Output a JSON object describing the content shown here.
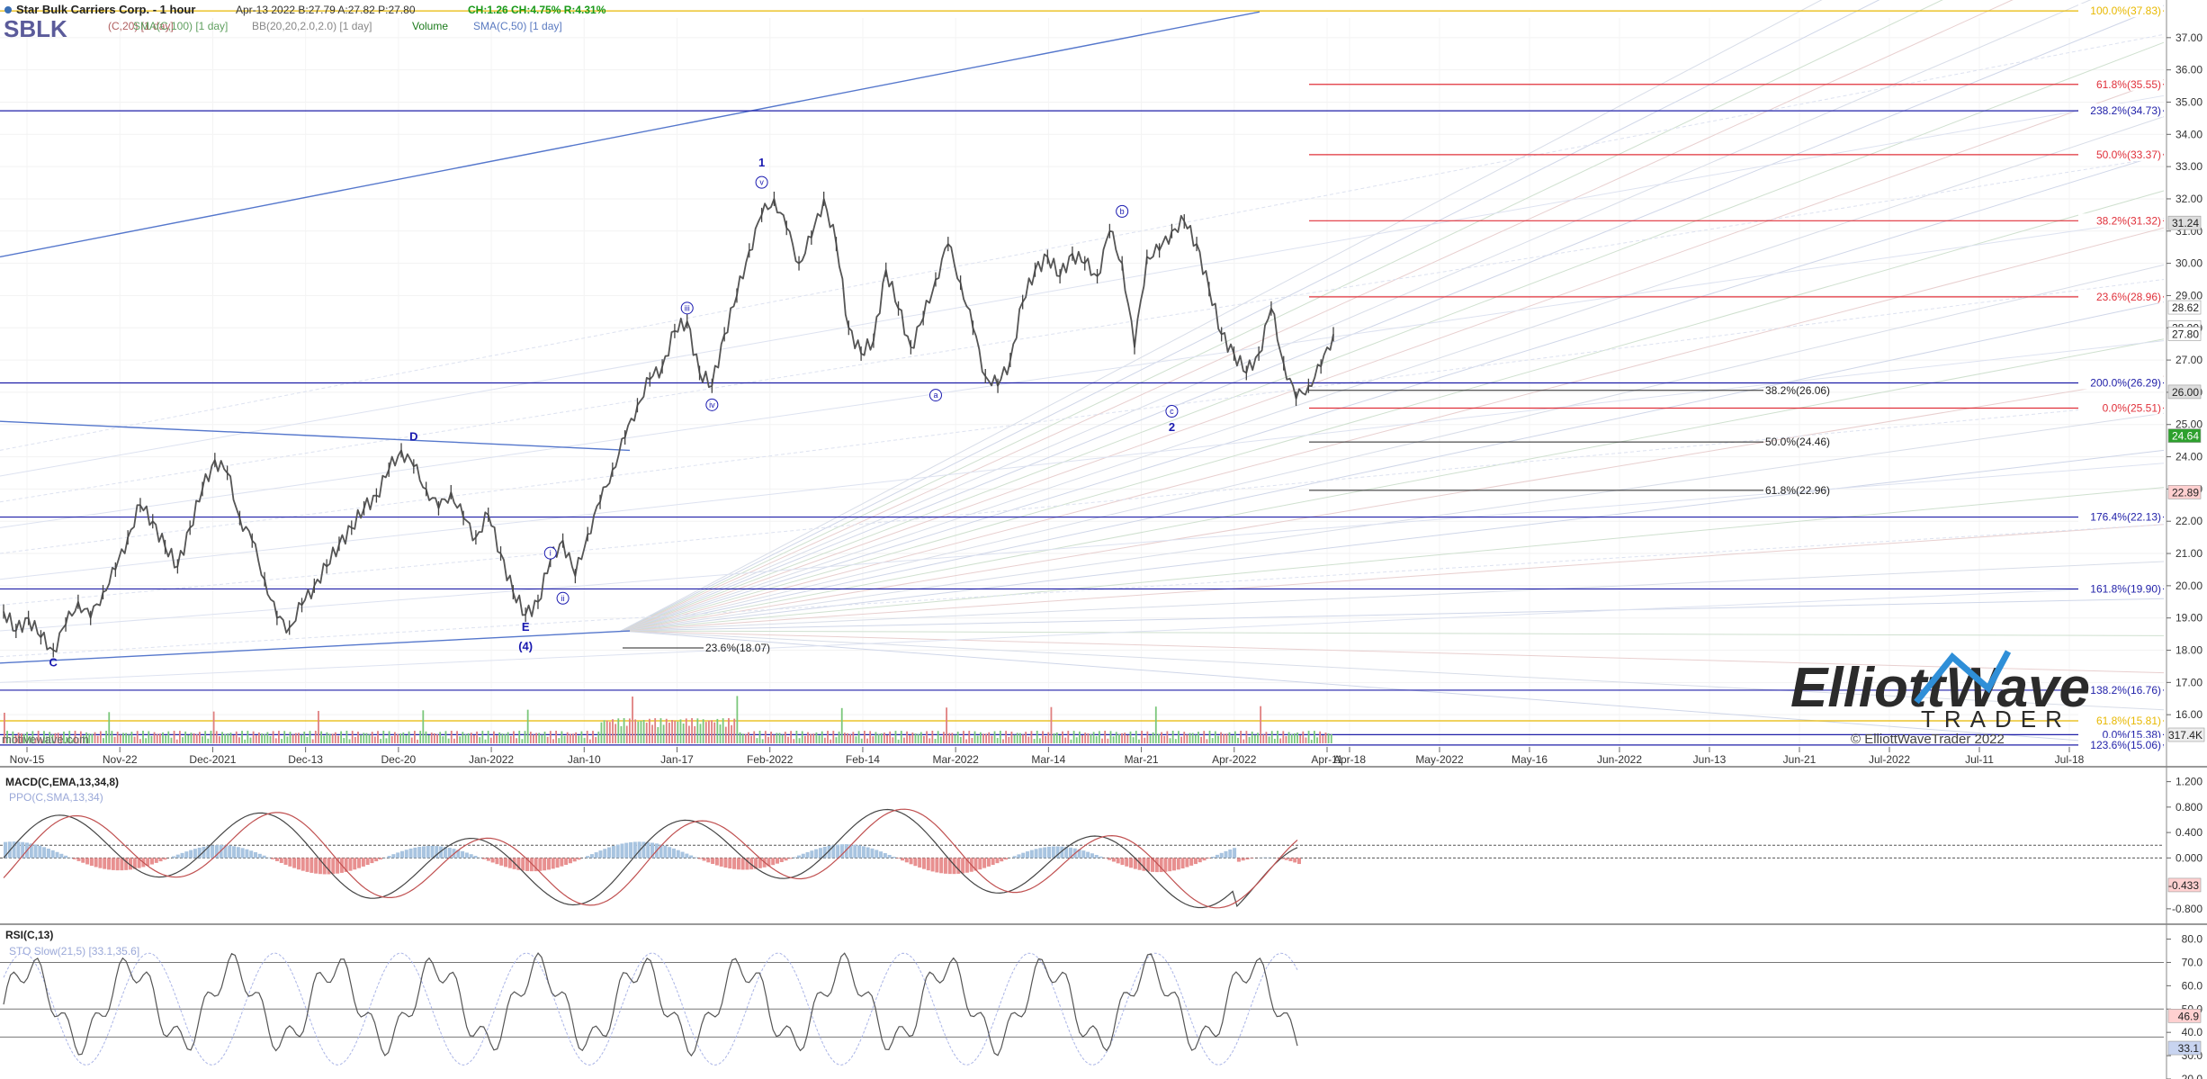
{
  "header": {
    "title": "Star Bulk Carriers Corp. - 1 hour",
    "ticker": "SBLK",
    "quote": "Apr-13 2022  B:27.79  A:27.82  P:27.80",
    "change": "CH:1.26  CH:4.75%  R:4.31%",
    "indicators": [
      "(C,20) [1 day]",
      "SMA(C,100) [1 day]",
      "BB(20,20,2.0,2.0) [1 day]",
      "Volume",
      "SMA(C,50) [1 day]"
    ]
  },
  "colors": {
    "price": "#555555",
    "blue_level": "#1f1fa8",
    "red_level": "#e0303a",
    "gold_level": "#e8b800",
    "wave_label": "#1a1ab0",
    "macd_pos": "#a8c4e0",
    "macd_neg": "#e89090",
    "up_vol": "#7bc77b",
    "down_vol": "#e08080"
  },
  "watermark": {
    "site": "motivewave.com",
    "copyright": "© ElliottWaveTrader 2022",
    "logo_line1": "ElliottWave",
    "logo_line2": "TRADER"
  },
  "chart_data": [
    {
      "type": "line",
      "panel": "price",
      "title": "Star Bulk Carriers Corp. - 1 hour",
      "ylim": [
        15,
        38
      ],
      "y_ticks": [
        16,
        17,
        18,
        19,
        20,
        21,
        22,
        23,
        24,
        25,
        26,
        27,
        28,
        29,
        30,
        31,
        32,
        33,
        34,
        35,
        36,
        37
      ],
      "x_labels": [
        "Nov-15",
        "Nov-22",
        "Dec-2021",
        "Dec-13",
        "Dec-20",
        "Jan-2022",
        "Jan-10",
        "Jan-17",
        "Feb-2022",
        "Feb-14",
        "Mar-2022",
        "Mar-14",
        "Mar-21",
        "Apr-2022",
        "Apr-11",
        "Apr-18",
        "May-2022",
        "May-16",
        "Jun-2022",
        "Jun-13",
        "Jun-21",
        "Jul-2022",
        "Jul-11",
        "Jul-18"
      ],
      "price_path": [
        [
          0,
          19.2
        ],
        [
          1,
          18.6
        ],
        [
          2,
          19.0
        ],
        [
          3,
          18.4
        ],
        [
          4,
          18.0
        ],
        [
          5,
          18.8
        ],
        [
          6,
          19.5
        ],
        [
          7,
          19.0
        ],
        [
          8,
          19.8
        ],
        [
          9,
          20.5
        ],
        [
          10,
          21.5
        ],
        [
          11,
          22.5
        ],
        [
          12,
          22.0
        ],
        [
          13,
          21.2
        ],
        [
          14,
          20.6
        ],
        [
          15,
          21.8
        ],
        [
          16,
          23.0
        ],
        [
          17,
          23.9
        ],
        [
          18,
          23.5
        ],
        [
          19,
          22.1
        ],
        [
          20,
          21.4
        ],
        [
          21,
          20.2
        ],
        [
          22,
          19.0
        ],
        [
          23,
          18.7
        ],
        [
          24,
          19.4
        ],
        [
          25,
          20.0
        ],
        [
          26,
          20.6
        ],
        [
          27,
          21.3
        ],
        [
          28,
          21.8
        ],
        [
          29,
          22.4
        ],
        [
          30,
          22.8
        ],
        [
          31,
          23.6
        ],
        [
          32,
          24.2
        ],
        [
          33,
          23.7
        ],
        [
          34,
          23.0
        ],
        [
          35,
          22.4
        ],
        [
          36,
          22.9
        ],
        [
          37,
          22.1
        ],
        [
          38,
          21.5
        ],
        [
          39,
          22.2
        ],
        [
          40,
          21.0
        ],
        [
          41,
          19.8
        ],
        [
          42,
          19.1
        ],
        [
          43,
          19.5
        ],
        [
          44,
          20.8
        ],
        [
          45,
          21.4
        ],
        [
          46,
          20.3
        ],
        [
          47,
          21.6
        ],
        [
          48,
          22.6
        ],
        [
          49,
          23.6
        ],
        [
          50,
          24.6
        ],
        [
          51,
          25.6
        ],
        [
          52,
          26.4
        ],
        [
          53,
          26.8
        ],
        [
          54,
          27.9
        ],
        [
          55,
          28.2
        ],
        [
          56,
          26.6
        ],
        [
          57,
          26.2
        ],
        [
          58,
          27.8
        ],
        [
          59,
          29.0
        ],
        [
          60,
          30.4
        ],
        [
          61,
          31.5
        ],
        [
          62,
          32.0
        ],
        [
          63,
          31.1
        ],
        [
          64,
          30.0
        ],
        [
          65,
          30.8
        ],
        [
          66,
          32.0
        ],
        [
          67,
          30.6
        ],
        [
          68,
          28.0
        ],
        [
          69,
          27.2
        ],
        [
          70,
          27.6
        ],
        [
          71,
          29.8
        ],
        [
          72,
          28.6
        ],
        [
          73,
          27.4
        ],
        [
          74,
          28.3
        ],
        [
          75,
          29.5
        ],
        [
          76,
          30.6
        ],
        [
          77,
          29.4
        ],
        [
          78,
          28.0
        ],
        [
          79,
          26.5
        ],
        [
          80,
          26.2
        ],
        [
          81,
          27.0
        ],
        [
          82,
          28.8
        ],
        [
          83,
          29.8
        ],
        [
          84,
          30.2
        ],
        [
          85,
          29.6
        ],
        [
          86,
          30.3
        ],
        [
          87,
          30.0
        ],
        [
          88,
          29.6
        ],
        [
          89,
          31.0
        ],
        [
          90,
          30.0
        ],
        [
          91,
          27.4
        ],
        [
          92,
          30.2
        ],
        [
          93,
          30.4
        ],
        [
          94,
          31.0
        ],
        [
          95,
          31.3
        ],
        [
          96,
          30.6
        ],
        [
          97,
          29.2
        ],
        [
          98,
          27.8
        ],
        [
          99,
          27.2
        ],
        [
          100,
          26.6
        ],
        [
          101,
          27.2
        ],
        [
          102,
          28.6
        ],
        [
          103,
          26.9
        ],
        [
          104,
          25.8
        ],
        [
          105,
          26.2
        ],
        [
          106,
          26.8
        ],
        [
          107,
          27.8
        ]
      ],
      "wave_labels": [
        {
          "text": "C",
          "x": 4,
          "y": 17.5
        },
        {
          "text": "D",
          "x": 33,
          "y": 24.5
        },
        {
          "text": "E",
          "x": 42,
          "y": 18.6
        },
        {
          "text": "(4)",
          "x": 42,
          "y": 18.0
        },
        {
          "text": "i",
          "x": 44,
          "y": 20.9,
          "circled": true
        },
        {
          "text": "ii",
          "x": 45,
          "y": 19.5,
          "circled": true
        },
        {
          "text": "iii",
          "x": 55,
          "y": 28.5,
          "circled": true
        },
        {
          "text": "iv",
          "x": 57,
          "y": 25.5,
          "circled": true
        },
        {
          "text": "1",
          "x": 61,
          "y": 33.0
        },
        {
          "text": "v",
          "x": 61,
          "y": 32.4,
          "circled": true
        },
        {
          "text": "a",
          "x": 75,
          "y": 25.8,
          "circled": true
        },
        {
          "text": "b",
          "x": 90,
          "y": 31.5,
          "circled": true
        },
        {
          "text": "c",
          "x": 94,
          "y": 25.3,
          "circled": true
        },
        {
          "text": "2",
          "x": 94,
          "y": 24.8
        }
      ],
      "fib_levels": [
        {
          "label": "100.0%(37.83)",
          "value": 37.83,
          "color": "gold"
        },
        {
          "label": "61.8%(35.55)",
          "value": 35.55,
          "color": "red"
        },
        {
          "label": "238.2%(34.73)",
          "value": 34.73,
          "color": "blue"
        },
        {
          "label": "50.0%(33.37)",
          "value": 33.37,
          "color": "red"
        },
        {
          "label": "38.2%(31.32)",
          "value": 31.32,
          "color": "red"
        },
        {
          "label": "23.6%(28.96)",
          "value": 28.96,
          "color": "red"
        },
        {
          "label": "200.0%(26.29)",
          "value": 26.29,
          "color": "blue"
        },
        {
          "label": "0.0%(25.51)",
          "value": 25.51,
          "color": "red"
        },
        {
          "label": "176.4%(22.13)",
          "value": 22.13,
          "color": "blue"
        },
        {
          "label": "161.8%(19.90)",
          "value": 19.9,
          "color": "blue"
        },
        {
          "label": "138.2%(16.76)",
          "value": 16.76,
          "color": "blue"
        },
        {
          "label": "61.8%(15.81)",
          "value": 15.81,
          "color": "gold"
        },
        {
          "label": "0.0%(15.38)",
          "value": 15.38,
          "color": "blue"
        },
        {
          "label": "123.6%(15.06)",
          "value": 15.06,
          "color": "blue"
        }
      ],
      "retracements": [
        {
          "label": "38.2%(26.06)",
          "value": 26.06
        },
        {
          "label": "50.0%(24.46)",
          "value": 24.46
        },
        {
          "label": "61.8%(22.96)",
          "value": 22.96
        },
        {
          "label": "23.6%(18.07)",
          "value": 18.07
        }
      ],
      "price_tags": [
        {
          "text": "31.24",
          "value": 31.24,
          "bg": "#dddddd"
        },
        {
          "text": "28.62",
          "value": 28.62,
          "bg": "#ffffff"
        },
        {
          "text": "28.00",
          "value": 28.0,
          "bg": "#ffffff"
        },
        {
          "text": "27.80",
          "value": 27.8,
          "bg": "#ffffff"
        },
        {
          "text": "26.00",
          "value": 26.0,
          "bg": "#dddddd"
        },
        {
          "text": "24.64",
          "value": 24.64,
          "bg": "#2da02d"
        },
        {
          "text": "22.89",
          "value": 22.89,
          "bg": "#ffd0d0"
        }
      ],
      "volume_label": "317.4K"
    },
    {
      "type": "line",
      "panel": "macd",
      "title": "MACD(C,EMA,13,34,8)",
      "subtitle": "PPO(C,SMA,13,34)",
      "ylim": [
        -1.0,
        1.35
      ],
      "y_ticks": [
        1.2,
        0.8,
        0.4,
        0.0,
        -0.8
      ],
      "current": "-0.433"
    },
    {
      "type": "line",
      "panel": "rsi",
      "title": "RSI(C,13)",
      "subtitle": "STO Slow(21,5) [33.1,35.6]",
      "ylim": [
        20,
        86
      ],
      "y_ticks": [
        80,
        70,
        60,
        50,
        40,
        30,
        20
      ],
      "current": [
        "46.9",
        "33.1"
      ]
    }
  ]
}
